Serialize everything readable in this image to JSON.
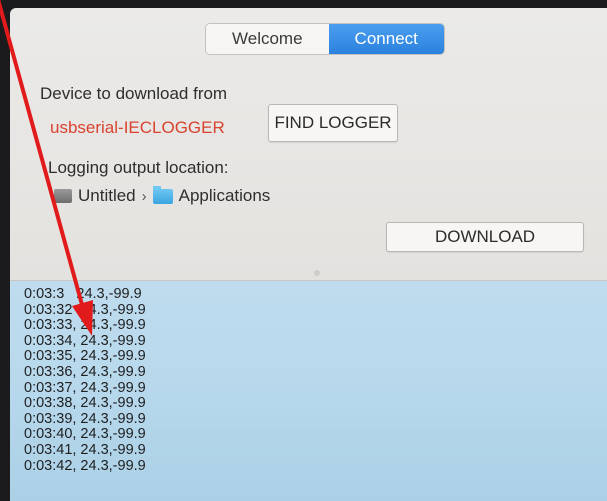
{
  "tabs": [
    {
      "label": "Welcome",
      "active": false
    },
    {
      "label": "Connect",
      "active": true
    }
  ],
  "device": {
    "heading": "Device to download from",
    "name": "usbserial-IECLOGGER",
    "name_color": "#d9432f",
    "find_button": "FIND LOGGER"
  },
  "output": {
    "heading": "Logging output location:",
    "path": [
      {
        "label": "Untitled",
        "icon": "drive-icon"
      },
      {
        "label": "Applications",
        "icon": "folder-icon"
      }
    ],
    "separator": "›"
  },
  "download_button": "DOWNLOAD",
  "log_lines": [
    "0:03:3   24.3,-99.9",
    "0:03:32  24.3,-99.9",
    "0:03:33, 24.3,-99.9",
    "0:03:34, 24.3,-99.9",
    "0:03:35, 24.3,-99.9",
    "0:03:36, 24.3,-99.9",
    "0:03:37, 24.3,-99.9",
    "0:03:38, 24.3,-99.9",
    "0:03:39, 24.3,-99.9",
    "0:03:40, 24.3,-99.9",
    "0:03:41, 24.3,-99.9",
    "0:03:42, 24.3,-99.9"
  ],
  "colors": {
    "accent": "#2b82dd",
    "annotation_arrow": "#e11b1b",
    "log_background": "#b7d8ec"
  }
}
